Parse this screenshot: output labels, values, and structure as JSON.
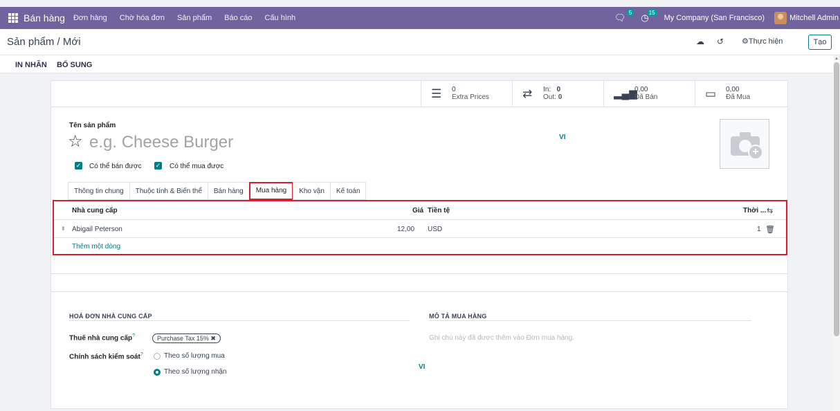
{
  "navbar": {
    "app_name": "Bán hàng",
    "menu": [
      "Đơn hàng",
      "Chờ hóa đơn",
      "Sản phẩm",
      "Báo cáo",
      "Cấu hình"
    ],
    "messages_count": "5",
    "activities_count": "15",
    "company": "My Company (San Francisco)",
    "user": "Mitchell Admin"
  },
  "control": {
    "breadcrumb": "Sản phẩm / Mới",
    "action_label": "Thực hiện",
    "new_label": "Tạo"
  },
  "statusbar": {
    "print_label": "IN NHÃN",
    "extra_label": "BỔ SUNG"
  },
  "smart_buttons": {
    "extra_prices": {
      "value": "0",
      "label": "Extra Prices"
    },
    "in_out": {
      "in_label": "In:",
      "in_value": "0",
      "out_label": "Out:",
      "out_value": "0"
    },
    "sold": {
      "value": "0,00",
      "label": "Đã Bán"
    },
    "purchased": {
      "value": "0,00",
      "label": "Đã Mua"
    }
  },
  "form": {
    "name_label": "Tên sản phẩm",
    "name_placeholder": "e.g. Cheese Burger",
    "lang": "VI",
    "can_be_sold": "Có thể bán được",
    "can_be_purchased": "Có thể mua được"
  },
  "tabs": [
    "Thông tin chung",
    "Thuộc tính & Biến thể",
    "Bán hàng",
    "Mua hàng",
    "Kho vận",
    "Kế toán"
  ],
  "vendor_list": {
    "headers": {
      "vendor": "Nhà cung cấp",
      "price": "Giá",
      "currency": "Tiền tệ",
      "lead_time": "Thời ..."
    },
    "rows": [
      {
        "vendor": "Abigail Peterson",
        "price": "12,00",
        "currency": "USD",
        "lead_time": "1"
      }
    ],
    "add_line": "Thêm một dòng"
  },
  "vendor_bills": {
    "title": "HOÁ ĐƠN NHÀ CUNG CẤP",
    "taxes_label": "Thuế nhà cung cấp",
    "tax_tag": "Purchase Tax 15%",
    "control_policy_label": "Chính sách kiểm soát",
    "policy_options": [
      "Theo số lượng mua",
      "Theo số lượng nhận"
    ],
    "help_mark": "?"
  },
  "purchase_description": {
    "title": "MÔ TẢ MUA HÀNG",
    "placeholder": "Ghi chú này đã được thêm vào Đơn mua hàng.",
    "lang": "VI"
  },
  "colors": {
    "navbar": "#71639e",
    "accent": "#017e84",
    "highlight": "#d61f30"
  }
}
